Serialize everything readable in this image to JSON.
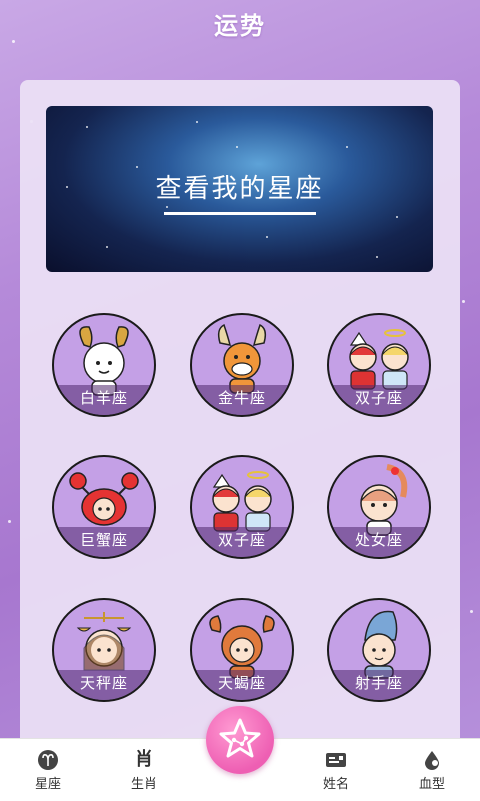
{
  "header": {
    "title": "运势"
  },
  "banner": {
    "label": "查看我的星座"
  },
  "zodiac_grid": [
    {
      "name": "白羊座",
      "icon": "aries-character-icon"
    },
    {
      "name": "金牛座",
      "icon": "taurus-character-icon"
    },
    {
      "name": "双子座",
      "icon": "gemini-character-icon"
    },
    {
      "name": "巨蟹座",
      "icon": "cancer-character-icon"
    },
    {
      "name": "双子座",
      "icon": "gemini-character-icon"
    },
    {
      "name": "处女座",
      "icon": "virgo-character-icon"
    },
    {
      "name": "天秤座",
      "icon": "libra-character-icon"
    },
    {
      "name": "天蝎座",
      "icon": "scorpio-character-icon"
    },
    {
      "name": "射手座",
      "icon": "sagittarius-character-icon"
    }
  ],
  "tabbar": {
    "tabs": [
      {
        "label": "星座",
        "icon": "aries-symbol-icon"
      },
      {
        "label": "生肖",
        "icon": "xiao-character-icon"
      },
      {
        "label": "",
        "icon": "star-constellation-icon"
      },
      {
        "label": "姓名",
        "icon": "name-card-icon"
      },
      {
        "label": "血型",
        "icon": "blood-drop-icon"
      }
    ]
  },
  "colors": {
    "background": "#b58ad9",
    "card": "#ece1f5",
    "circle": "#c4a0e6",
    "fab": "#ee5fb3"
  }
}
